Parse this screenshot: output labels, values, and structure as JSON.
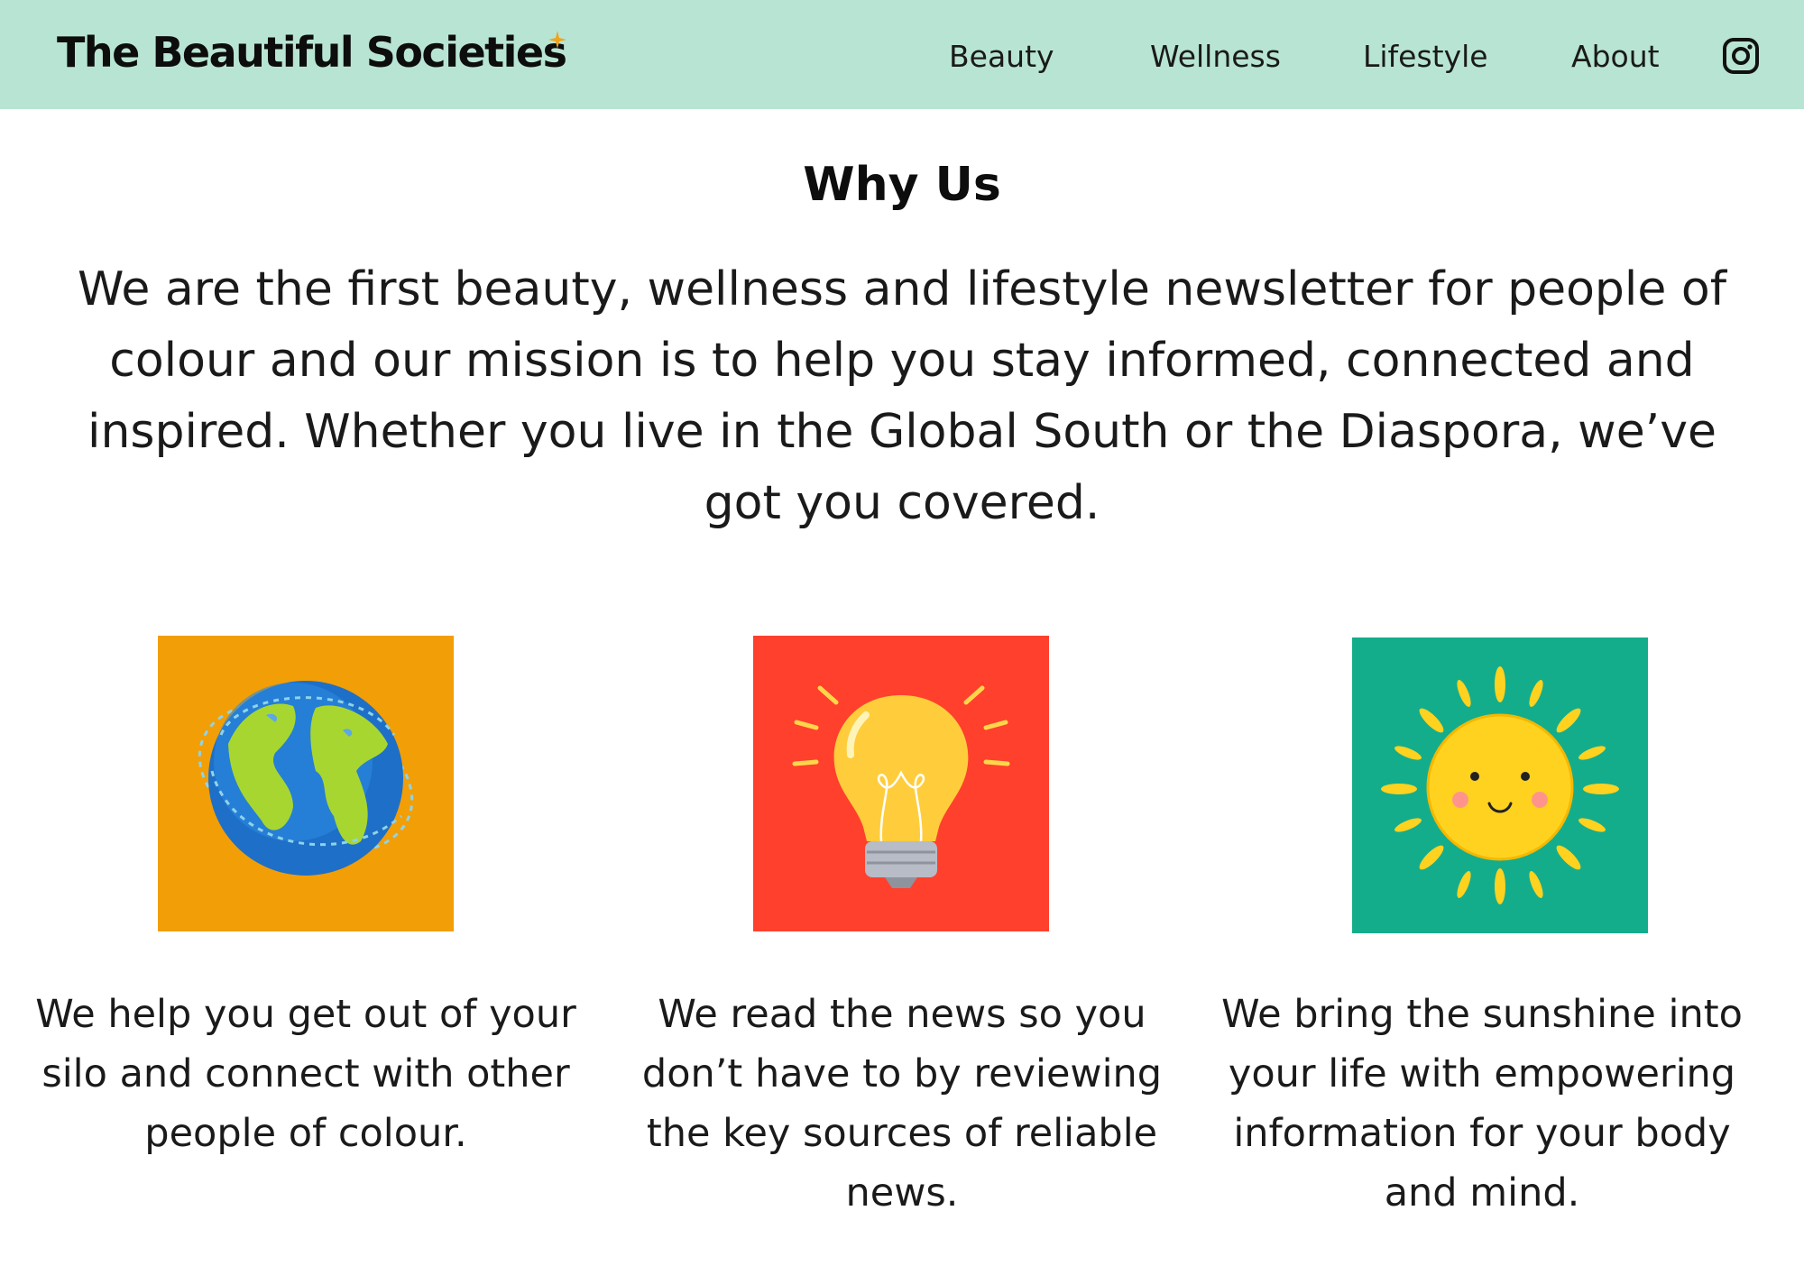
{
  "header": {
    "brand": "The Beautiful Societies",
    "nav": [
      {
        "label": "Beauty"
      },
      {
        "label": "Wellness"
      },
      {
        "label": "Lifestyle"
      },
      {
        "label": "About"
      }
    ],
    "social_icon": "instagram-icon"
  },
  "main": {
    "title": "Why Us",
    "intro": "We are the first beauty, wellness and lifestyle newsletter for people of colour and our mission is to help you stay informed, connected and inspired. Whether you live in the Global South or the Diaspora, we’ve got you covered.",
    "features": [
      {
        "icon": "globe-icon",
        "text": "We help you get out of your silo and connect with other people of colour."
      },
      {
        "icon": "lightbulb-icon",
        "text": "We read the news so you don’t have to by reviewing the key sources of reliable news."
      },
      {
        "icon": "sun-icon",
        "text": "We bring the sunshine into your life with empowering information for your body and mind."
      }
    ]
  },
  "colors": {
    "header_bg": "#b8e5d3",
    "accent_star": "#f2a31b",
    "tile_globe_bg": "#f29e06",
    "tile_bulb_bg": "#ff402d",
    "tile_sun_bg": "#14ad8c"
  }
}
